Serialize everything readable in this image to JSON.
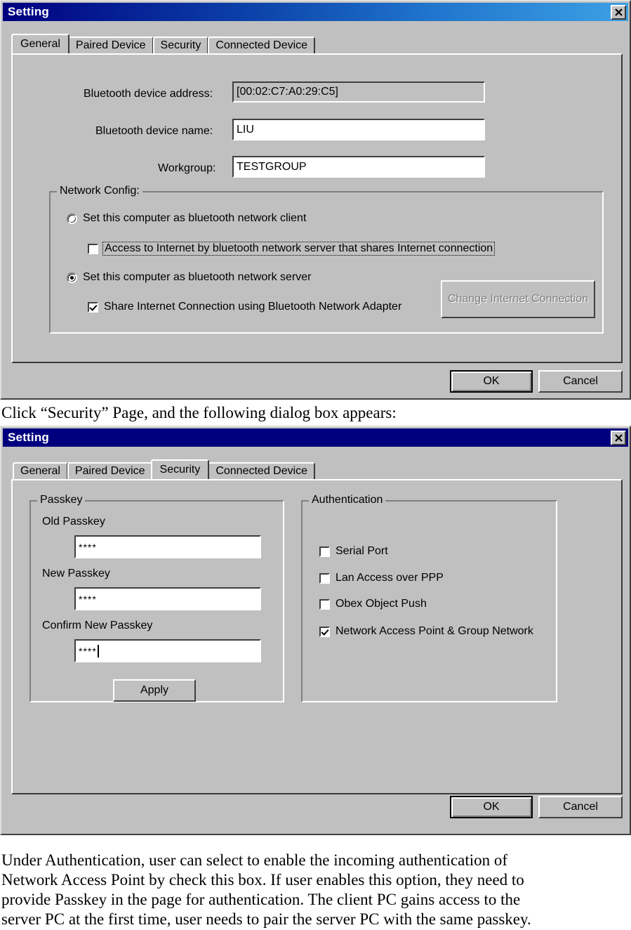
{
  "colors": {
    "titlebar_gradient_start": "#000080",
    "titlebar_gradient_end": "#3da0e4",
    "titlebar_solid": "#00007e",
    "dialog_face": "#c0c0c0",
    "field_background": "#ffffff",
    "disabled_text": "#808080"
  },
  "dialog_general": {
    "title": "Setting",
    "close_icon": "close-icon",
    "tabs": [
      {
        "label": "General",
        "active": true
      },
      {
        "label": "Paired Device",
        "active": false
      },
      {
        "label": "Security",
        "active": false
      },
      {
        "label": "Connected Device",
        "active": false
      }
    ],
    "fields": [
      {
        "label": "Bluetooth device address:",
        "value": "[00:02:C7:A0:29:C5]",
        "disabled": true
      },
      {
        "label": "Bluetooth device name:",
        "value": "LIU",
        "disabled": false
      },
      {
        "label": "Workgroup:",
        "value": "TESTGROUP",
        "disabled": false
      }
    ],
    "network_config": {
      "title": "Network Config:",
      "radio_client": {
        "label": "Set this computer as bluetooth network client",
        "checked": false
      },
      "check_access_internet": {
        "label": "Access to Internet by bluetooth network server that shares Internet connection",
        "checked": false,
        "focused": true
      },
      "radio_server": {
        "label": "Set this computer as bluetooth network server",
        "checked": true
      },
      "check_share_connection": {
        "label": "Share Internet Connection using Bluetooth Network Adapter",
        "checked": true
      },
      "change_button": {
        "label": "Change Internet Connection",
        "disabled": true
      }
    },
    "buttons": {
      "ok": "OK",
      "cancel": "Cancel"
    }
  },
  "caption": "Click “Security” Page, and the following dialog box appears:",
  "dialog_security": {
    "title": "Setting",
    "close_icon": "close-icon",
    "tabs": [
      {
        "label": "General",
        "active": false
      },
      {
        "label": "Paired Device",
        "active": false
      },
      {
        "label": "Security",
        "active": true
      },
      {
        "label": "Connected Device",
        "active": false
      }
    ],
    "passkey_group": {
      "title": "Passkey",
      "old_label": "Old Passkey",
      "old_value": "****",
      "new_label": "New Passkey",
      "new_value": "****",
      "confirm_label": "Confirm New Passkey",
      "confirm_value": "****",
      "apply_button": "Apply"
    },
    "authentication_group": {
      "title": "Authentication",
      "items": [
        {
          "label": "Serial Port",
          "checked": false
        },
        {
          "label": "Lan Access over PPP",
          "checked": false
        },
        {
          "label": "Obex Object Push",
          "checked": false
        },
        {
          "label": "Network Access Point & Group Network",
          "checked": true
        }
      ]
    },
    "buttons": {
      "ok": "OK",
      "cancel": "Cancel"
    }
  },
  "footer_paragraph": "Under Authentication, user can select to enable the incoming authentication of\nNetwork Access Point by check this box. If user enables this option, they need to\nprovide Passkey in the page for authentication. The client PC gains access to the\nserver PC at the first time, user needs to pair the server PC with the same passkey."
}
